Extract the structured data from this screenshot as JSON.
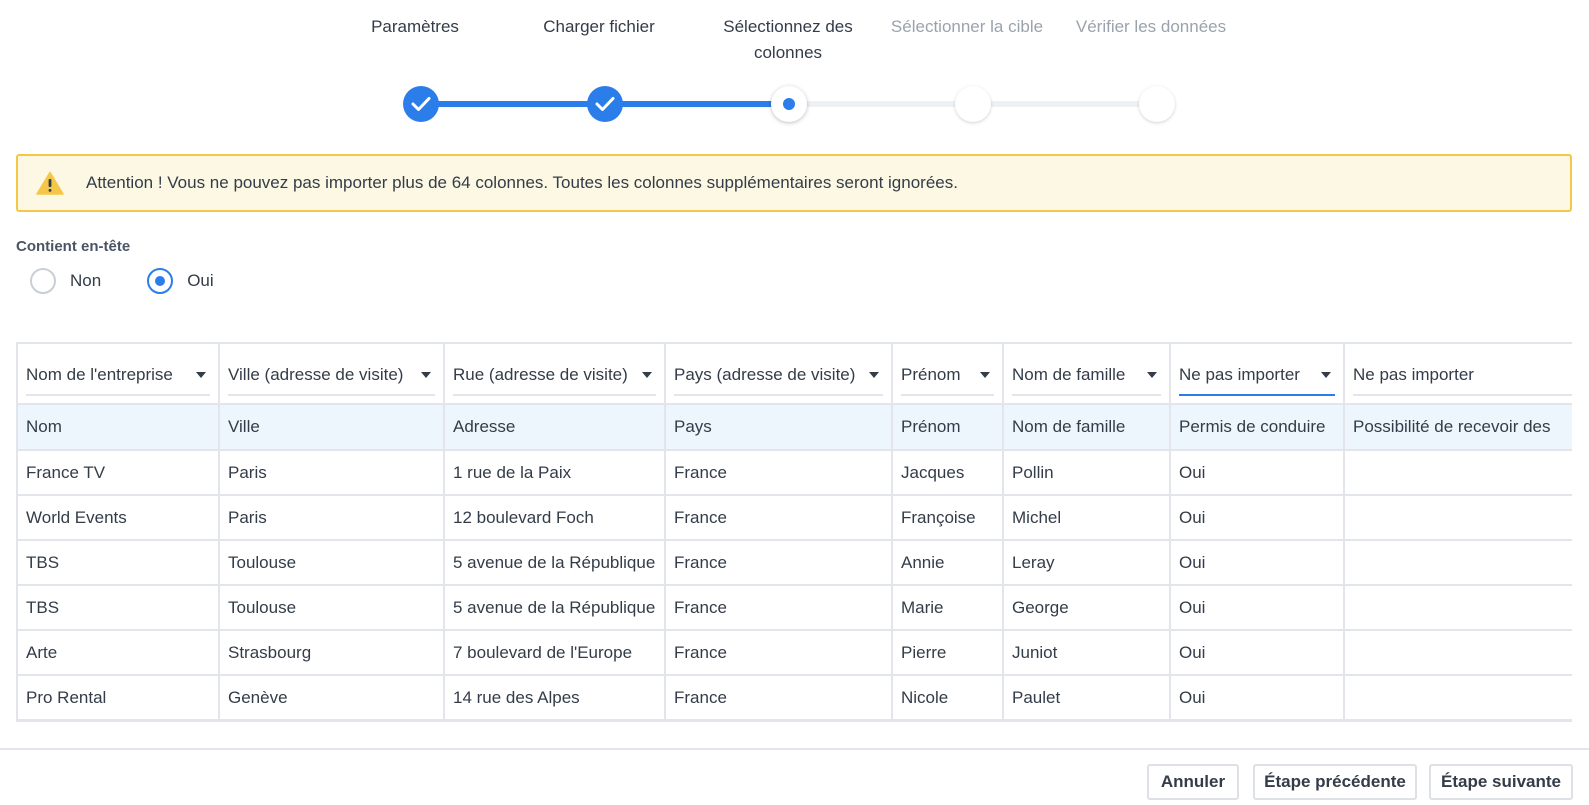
{
  "stepper": {
    "steps": [
      {
        "label": "Paramètres",
        "state": "done"
      },
      {
        "label": "Charger fichier",
        "state": "done"
      },
      {
        "label": "Sélectionnez des colonnes",
        "state": "current"
      },
      {
        "label": "Sélectionner la cible",
        "state": "todo"
      },
      {
        "label": "Vérifier les données",
        "state": "todo"
      }
    ]
  },
  "warning": {
    "text": "Attention ! Vous ne pouvez pas importer plus de 64 colonnes. Toutes les colonnes supplémentaires seront ignorées.",
    "icon": "warning-icon",
    "color": "#f5c748"
  },
  "header_option": {
    "label": "Contient en-tête",
    "options": [
      "Non",
      "Oui"
    ],
    "selected": "Oui"
  },
  "table": {
    "mappings": [
      "Nom de l'entreprise",
      "Ville (adresse de visite)",
      "Rue (adresse de visite)",
      "Pays (adresse de visite)",
      "Prénom",
      "Nom de famille",
      "Ne pas importer",
      "Ne pas importer"
    ],
    "headers": [
      "Nom",
      "Ville",
      "Adresse",
      "Pays",
      "Prénom",
      "Nom de famille",
      "Permis de conduire",
      "Possibilité de recevoir des"
    ],
    "rows": [
      [
        "France TV",
        "Paris",
        "1 rue de la Paix",
        "France",
        "Jacques",
        "Pollin",
        "Oui",
        ""
      ],
      [
        "World Events",
        "Paris",
        "12 boulevard Foch",
        "France",
        "Françoise",
        "Michel",
        "Oui",
        ""
      ],
      [
        "TBS",
        "Toulouse",
        "5 avenue de la République",
        "France",
        "Annie",
        "Leray",
        "Oui",
        ""
      ],
      [
        "TBS",
        "Toulouse",
        "5 avenue de la République",
        "France",
        "Marie",
        "George",
        "Oui",
        ""
      ],
      [
        "Arte",
        "Strasbourg",
        "7 boulevard de l'Europe",
        "France",
        "Pierre",
        "Juniot",
        "Oui",
        ""
      ],
      [
        "Pro Rental",
        "Genève",
        "14 rue des Alpes",
        "France",
        "Nicole",
        "Paulet",
        "Oui",
        ""
      ]
    ]
  },
  "footer": {
    "cancel_label": "Annuler",
    "prev_label": "Étape précédente",
    "next_label": "Étape suivante"
  },
  "colors": {
    "accent": "#2b7de9",
    "warning_bg": "#fcf8e3",
    "header_row_bg": "#eef6fd"
  }
}
